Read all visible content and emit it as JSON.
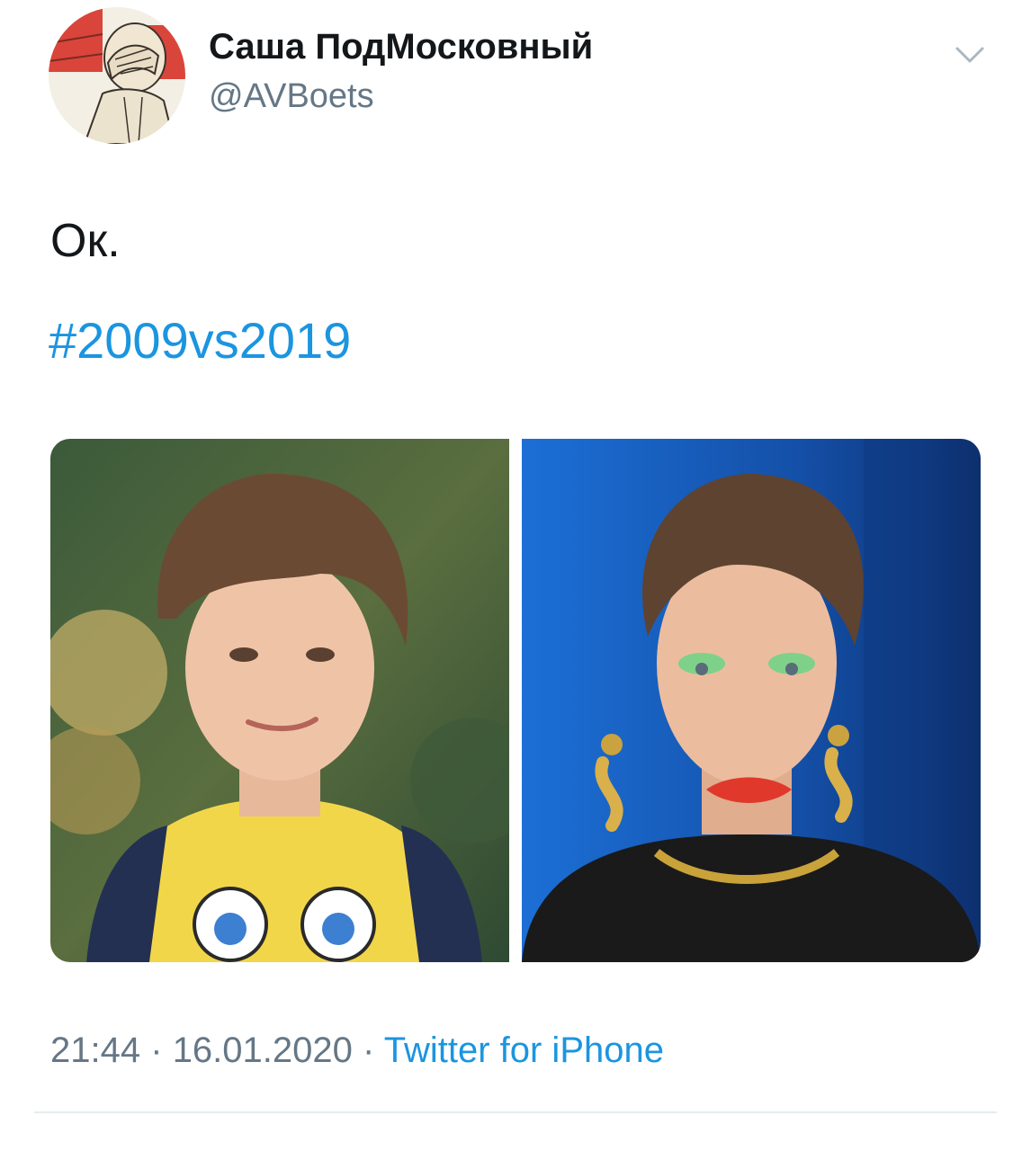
{
  "tweet": {
    "author": {
      "display_name": "Саша ПодМосковный",
      "handle": "@AVBoets",
      "avatar_icon": "facepalm-avatar"
    },
    "menu_icon": "chevron-down-icon",
    "text": "Ок.",
    "hashtag": "#2009vs2019",
    "media": [
      {
        "description": "child-portrait-photo"
      },
      {
        "description": "adult-makeup-photo"
      }
    ],
    "time": "21:44",
    "separator": "·",
    "date": "16.01.2020",
    "source": "Twitter for iPhone"
  },
  "colors": {
    "text": "#14171a",
    "secondary": "#657786",
    "link": "#1b95e0",
    "divider": "#e6ecf0"
  }
}
